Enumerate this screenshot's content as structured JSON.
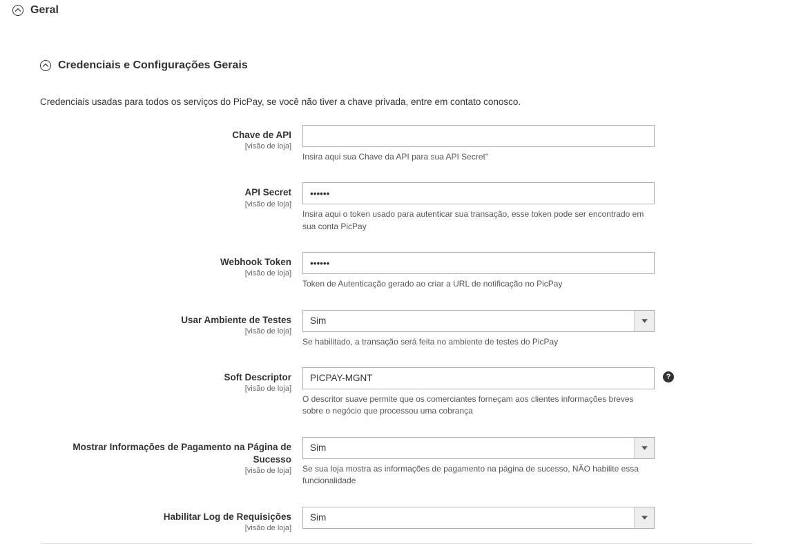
{
  "section_main": {
    "title": "Geral"
  },
  "section_sub": {
    "title": "Credenciais e Configurações Gerais",
    "description": "Credenciais usadas para todos os serviços do PicPay, se você não tiver a chave privada, entre em contato conosco."
  },
  "scope_label": "[visão de loja]",
  "fields": {
    "api_key": {
      "label": "Chave de API",
      "value": "",
      "help": "Insira aqui sua Chave da API para sua API Secret\""
    },
    "api_secret": {
      "label": "API Secret",
      "value": "••••••",
      "help": "Insira aqui o token usado para autenticar sua transação, esse token pode ser encontrado em sua conta PicPay"
    },
    "webhook_token": {
      "label": "Webhook Token",
      "value": "••••••",
      "help": "Token de Autenticação gerado ao criar a URL de notificação no PicPay"
    },
    "test_env": {
      "label": "Usar Ambiente de Testes",
      "value": "Sim",
      "help": "Se habilitado, a transação será feita no ambiente de testes do PicPay"
    },
    "soft_descriptor": {
      "label": "Soft Descriptor",
      "value": "PICPAY-MGNT",
      "help": "O descritor suave permite que os comerciantes forneçam aos clientes informações breves sobre o negócio que processou uma cobrança"
    },
    "show_payment_info": {
      "label": "Mostrar Informações de Pagamento na Página de Sucesso",
      "value": "Sim",
      "help": "Se sua loja mostra as informações de pagamento na página de sucesso, NÃO habilite essa funcionalidade"
    },
    "enable_log": {
      "label": "Habilitar Log de Requisições",
      "value": "Sim"
    }
  },
  "tooltip_char": "?"
}
